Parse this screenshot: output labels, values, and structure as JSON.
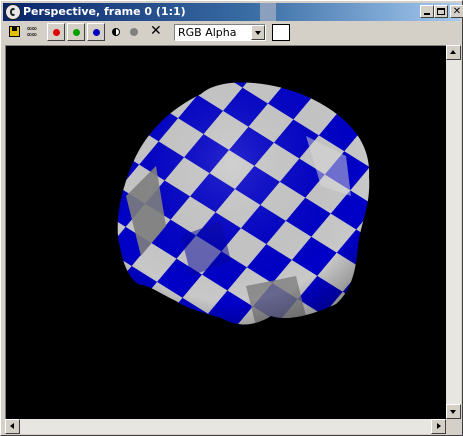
{
  "window": {
    "title": "Perspective, frame 0 (1:1)",
    "caption_buttons": [
      "minimize-icon",
      "maximize-icon",
      "close-icon"
    ]
  },
  "toolbar": {
    "buttons": [
      {
        "name": "save-bitmap",
        "icon": "save-icon"
      },
      {
        "name": "clone-window",
        "icon": "clone-icon"
      },
      {
        "name": "red-channel",
        "icon": "red-dot-icon",
        "color": "#e00000"
      },
      {
        "name": "green-channel",
        "icon": "green-dot-icon",
        "color": "#00a000"
      },
      {
        "name": "blue-channel",
        "icon": "blue-dot-icon",
        "color": "#0000c0"
      },
      {
        "name": "monochrome",
        "icon": "half-circle-icon"
      },
      {
        "name": "alpha-gray",
        "icon": "gray-dot-icon"
      },
      {
        "name": "clear",
        "icon": "x-icon"
      }
    ],
    "channel_select": {
      "value": "RGB Alpha"
    },
    "color_swatch": "#ffffff"
  },
  "viewport": {
    "background": "#000000",
    "scene": "checkered-sphere",
    "checker_colors": [
      "#0000c8",
      "#c8c8c8"
    ]
  }
}
